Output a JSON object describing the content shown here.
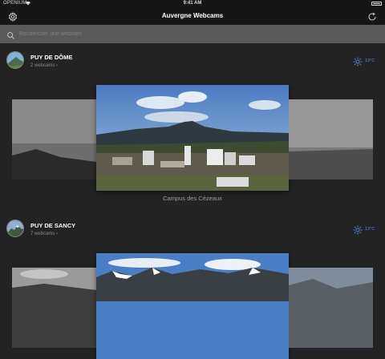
{
  "status_bar": {
    "carrier": "OPENIUM",
    "time": "9:41 AM",
    "battery": 1.0
  },
  "nav": {
    "title": "Auvergne Webcams",
    "left_icon": "settings-gear-icon",
    "right_icon": "refresh-icon"
  },
  "search": {
    "placeholder": "Rechercher une webcam",
    "value": ""
  },
  "locations": [
    {
      "name": "PUY DE DÔME",
      "count_label": "2 webcams",
      "temperature": "13°C",
      "weather_icon": "sun-icon",
      "main_caption": "Campus des Cézeaux"
    },
    {
      "name": "PUY DE SANCY",
      "count_label": "7 webcams",
      "temperature": "13°C",
      "weather_icon": "sun-icon"
    }
  ],
  "colors": {
    "accent": "#4a90e2",
    "background": "#232323",
    "bar": "#161616",
    "search_bg": "#5a5a5a"
  }
}
